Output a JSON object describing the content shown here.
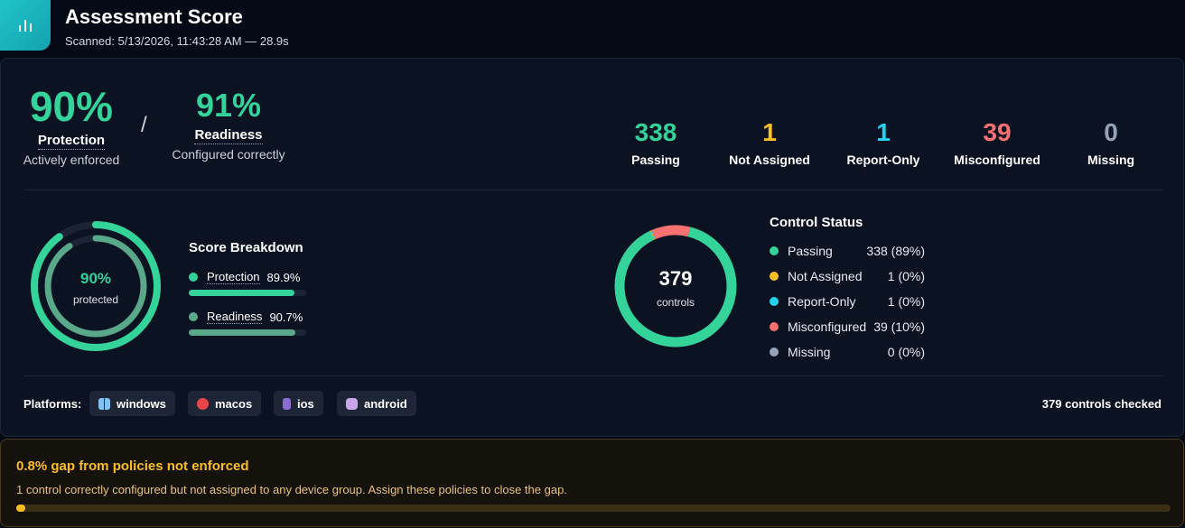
{
  "header": {
    "title": "Assessment Score",
    "subtitle": "Scanned: 5/13/2026, 11:43:28 AM — 28.9s",
    "icon": "bar-chart-icon"
  },
  "summary": {
    "protection": {
      "value": "90%",
      "label": "Protection",
      "desc": "Actively enforced"
    },
    "separator": "/",
    "readiness": {
      "value": "91%",
      "label": "Readiness",
      "desc": "Configured correctly"
    }
  },
  "stats": [
    {
      "value": "338",
      "label": "Passing",
      "color": "#34d399"
    },
    {
      "value": "1",
      "label": "Not Assigned",
      "color": "#fbbf24"
    },
    {
      "value": "1",
      "label": "Report-Only",
      "color": "#22d3ee"
    },
    {
      "value": "39",
      "label": "Misconfigured",
      "color": "#f87171"
    },
    {
      "value": "0",
      "label": "Missing",
      "color": "#94a3b8"
    }
  ],
  "score_ring": {
    "value": "90%",
    "caption": "protected",
    "outer_pct": 89.9,
    "inner_pct": 90.7
  },
  "score_breakdown": {
    "title": "Score Breakdown",
    "items": [
      {
        "name": "Protection",
        "value": "89.9%",
        "pct": 89.9,
        "color": "#34d399"
      },
      {
        "name": "Readiness",
        "value": "90.7%",
        "pct": 90.7,
        "color": "#5aa88a"
      }
    ]
  },
  "controls_ring": {
    "value": "379",
    "caption": "controls"
  },
  "control_status": {
    "title": "Control Status",
    "items": [
      {
        "name": "Passing",
        "count": "338 (89%)",
        "n": 338,
        "color": "#34d399"
      },
      {
        "name": "Not Assigned",
        "count": "1 (0%)",
        "n": 1,
        "color": "#fbbf24"
      },
      {
        "name": "Report-Only",
        "count": "1 (0%)",
        "n": 1,
        "color": "#22d3ee"
      },
      {
        "name": "Misconfigured",
        "count": "39 (10%)",
        "n": 39,
        "color": "#f87171"
      },
      {
        "name": "Missing",
        "count": "0 (0%)",
        "n": 0,
        "color": "#94a3b8"
      }
    ]
  },
  "platforms": {
    "label": "Platforms:",
    "items": [
      {
        "name": "windows",
        "icon": "windows-icon"
      },
      {
        "name": "macos",
        "icon": "apple-icon"
      },
      {
        "name": "ios",
        "icon": "phone-icon"
      },
      {
        "name": "android",
        "icon": "robot-icon"
      }
    ],
    "checked": "379 controls checked"
  },
  "gap": {
    "title": "0.8% gap from policies not enforced",
    "desc": "1 control correctly configured but not assigned to any device group. Assign these policies to close the gap.",
    "pct": 0.8
  }
}
